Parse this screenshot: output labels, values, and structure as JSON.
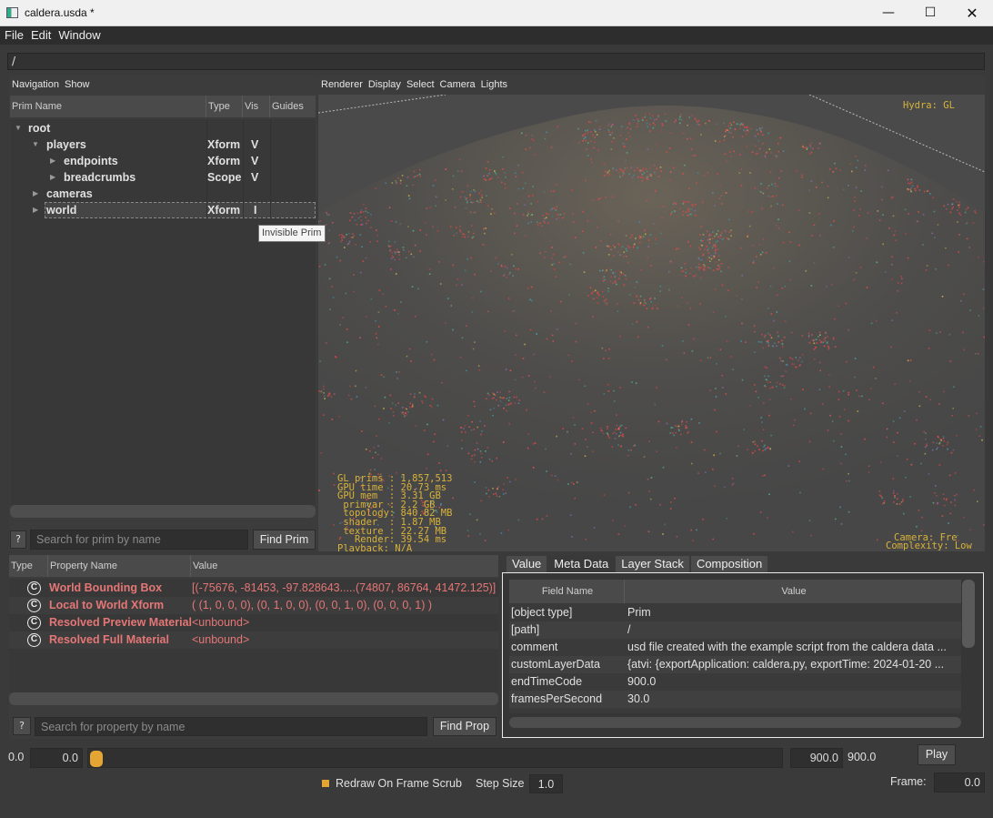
{
  "window": {
    "title": "caldera.usda *"
  },
  "menu": [
    "File",
    "Edit",
    "Window"
  ],
  "path": "/",
  "prim_browser": {
    "tabs": [
      "Navigation",
      "Show"
    ],
    "columns": [
      "Prim Name",
      "Type",
      "Vis",
      "Guides"
    ],
    "rows": [
      {
        "name": "root",
        "type": "",
        "vis": "",
        "indent": 0,
        "expanded": true
      },
      {
        "name": "players",
        "type": "Xform",
        "vis": "V",
        "indent": 1,
        "expanded": true
      },
      {
        "name": "endpoints",
        "type": "Xform",
        "vis": "V",
        "indent": 2,
        "expanded": false
      },
      {
        "name": "breadcrumbs",
        "type": "Scope",
        "vis": "V",
        "indent": 2,
        "expanded": false
      },
      {
        "name": "cameras",
        "type": "",
        "vis": "",
        "indent": 1,
        "expanded": false
      },
      {
        "name": "world",
        "type": "Xform",
        "vis": "I",
        "indent": 1,
        "expanded": false
      }
    ],
    "tooltip": "Invisible Prim",
    "help_label": "?",
    "search_placeholder": "Search for prim by name",
    "find_label": "Find Prim"
  },
  "viewport": {
    "menu": [
      "Renderer",
      "Display",
      "Select",
      "Camera",
      "Lights"
    ],
    "renderer_label": "Hydra: GL",
    "stats": "GL prims : 1,857,513\nGPU time : 20.73 ms\nGPU mem  : 3.31 GB\n primvar : 2.2 GB\n topology: 840.82 MB\n shader  : 1.87 MB\n texture : 22.27 MB\n   Render: 39.54 ms\nPlayback: N/A",
    "camera_text": "Camera: Fre",
    "complexity_text": "Complexity: Low"
  },
  "properties": {
    "columns": [
      "Type",
      "Property Name",
      "Value"
    ],
    "rows": [
      {
        "icon": "C",
        "name": "World Bounding Box",
        "value": "[(-75676, -81453, -97.828643.....(74807, 86764, 41472.125)]"
      },
      {
        "icon": "C",
        "name": "Local to World Xform",
        "value": "( (1, 0, 0, 0), (0, 1, 0, 0), (0, 0, 1, 0), (0, 0, 0, 1) )"
      },
      {
        "icon": "C",
        "name": "Resolved Preview Material",
        "value": "<unbound>"
      },
      {
        "icon": "C",
        "name": "Resolved Full Material",
        "value": "<unbound>"
      }
    ],
    "help_label": "?",
    "search_placeholder": "Search for property by name",
    "find_label": "Find Prop"
  },
  "metadata": {
    "tabs": [
      "Value",
      "Meta Data",
      "Layer Stack",
      "Composition"
    ],
    "active_tab": "Meta Data",
    "columns": [
      "Field Name",
      "Value"
    ],
    "rows": [
      {
        "field": "[object type]",
        "value": "Prim"
      },
      {
        "field": "[path]",
        "value": "/"
      },
      {
        "field": "comment",
        "value": "usd file created with the example script from the caldera data ..."
      },
      {
        "field": "customLayerData",
        "value": "{atvi: {exportApplication: caldera.py, exportTime: 2024-01-20 ..."
      },
      {
        "field": "endTimeCode",
        "value": "900.0"
      },
      {
        "field": "framesPerSecond",
        "value": "30.0"
      }
    ]
  },
  "timeline": {
    "start_label": "0.0",
    "start_value": "0.0",
    "current_fraction": 0.0,
    "end_value": "900.0",
    "end_label": "900.0",
    "play_label": "Play",
    "redraw_label": "Redraw On Frame Scrub",
    "redraw_checked": true,
    "step_label": "Step Size",
    "step_value": "1.0",
    "frame_label": "Frame:",
    "frame_value": "0.0"
  },
  "colors": {
    "accent": "#e4a533",
    "property_text": "#e57676",
    "hud_text": "#d8b23a"
  }
}
